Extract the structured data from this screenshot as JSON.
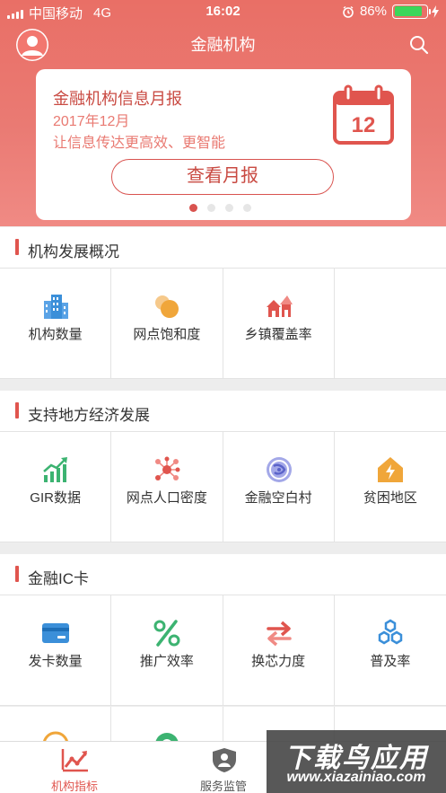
{
  "status_bar": {
    "carrier": "中国移动",
    "network": "4G",
    "time": "16:02",
    "battery": "86%",
    "battery_level": 0.86
  },
  "header": {
    "title": "金融机构"
  },
  "banner": {
    "title": "金融机构信息月报",
    "date": "2017年12月",
    "description": "让信息传达更高效、更智能",
    "calendar_day": "12",
    "button_label": "查看月报",
    "dots_total": 4,
    "active_dot": 0
  },
  "sections": [
    {
      "title": "机构发展概况",
      "items": [
        {
          "label": "机构数量",
          "icon": "building-icon"
        },
        {
          "label": "网点饱和度",
          "icon": "circles-icon"
        },
        {
          "label": "乡镇覆盖率",
          "icon": "village-icon"
        },
        {
          "label": "",
          "icon": ""
        }
      ]
    },
    {
      "title": "支持地方经济发展",
      "items": [
        {
          "label": "GIR数据",
          "icon": "growth-chart-icon"
        },
        {
          "label": "网点人口密度",
          "icon": "network-nodes-icon"
        },
        {
          "label": "金融空白村",
          "icon": "globe-icon"
        },
        {
          "label": "贫困地区",
          "icon": "house-lightning-icon"
        }
      ]
    },
    {
      "title": "金融IC卡",
      "items": [
        {
          "label": "发卡数量",
          "icon": "card-icon"
        },
        {
          "label": "推广效率",
          "icon": "percent-icon"
        },
        {
          "label": "换芯力度",
          "icon": "swap-arrows-icon"
        },
        {
          "label": "普及率",
          "icon": "hexagons-icon"
        }
      ]
    }
  ],
  "tabbar": {
    "tabs": [
      {
        "label": "机构指标",
        "icon": "trend-chart-icon",
        "active": true
      },
      {
        "label": "服务监管",
        "icon": "shield-user-icon",
        "active": false
      }
    ]
  },
  "watermark": {
    "line1": "下载鸟应用",
    "line2": "www.xiazainiao.com"
  },
  "colors": {
    "brand": "#e0554e",
    "blue": "#3b8fd9",
    "orange": "#f0a63a",
    "green": "#3cb371"
  }
}
